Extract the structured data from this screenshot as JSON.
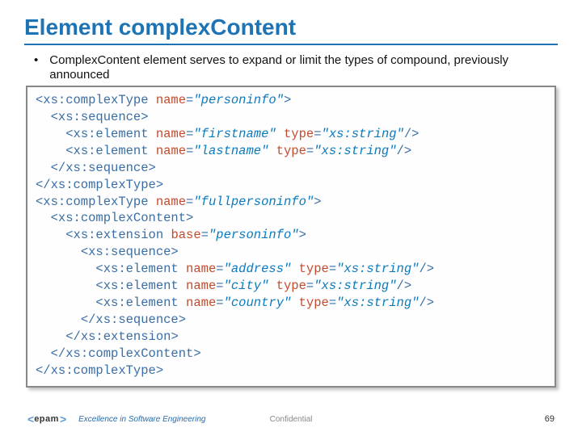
{
  "title": "Element complexContent",
  "bullet": "ComplexContent element serves to expand or limit the types of compound, previously announced",
  "code": {
    "l1": {
      "o": "<xs:complexType",
      "a1": " name",
      "v1": "\"personinfo\"",
      "c": ">"
    },
    "l2": {
      "t": "<xs:sequence>"
    },
    "l3": {
      "o": "<xs:element",
      "a1": " name",
      "v1": "\"firstname\"",
      "a2": " type",
      "v2": "\"xs:string\"",
      "c": "/>"
    },
    "l4": {
      "o": "<xs:element",
      "a1": " name",
      "v1": "\"lastname\"",
      "a2": " type",
      "v2": "\"xs:string\"",
      "c": "/>"
    },
    "l5": {
      "t": "</xs:sequence>"
    },
    "l6": {
      "t": "</xs:complexType>"
    },
    "l7": {
      "o": "<xs:complexType",
      "a1": " name",
      "v1": "\"fullpersoninfo\"",
      "c": ">"
    },
    "l8": {
      "t": "<xs:complexContent>"
    },
    "l9": {
      "o": "<xs:extension",
      "a1": " base",
      "v1": "\"personinfo\"",
      "c": ">"
    },
    "l10": {
      "t": "<xs:sequence>"
    },
    "l11": {
      "o": "<xs:element",
      "a1": " name",
      "v1": "\"address\"",
      "a2": " type",
      "v2": "\"xs:string\"",
      "c": "/>"
    },
    "l12": {
      "o": "<xs:element",
      "a1": " name",
      "v1": "\"city\"",
      "a2": " type",
      "v2": "\"xs:string\"",
      "c": "/>"
    },
    "l13": {
      "o": "<xs:element",
      "a1": " name",
      "v1": "\"country\"",
      "a2": " type",
      "v2": "\"xs:string\"",
      "c": "/>"
    },
    "l14": {
      "t": "</xs:sequence>"
    },
    "l15": {
      "t": "</xs:extension>"
    },
    "l16": {
      "t": "</xs:complexContent>"
    },
    "l17": {
      "t": "</xs:complexType>"
    }
  },
  "footer": {
    "logo_brand": "epam",
    "logo_open": "<",
    "logo_close": ">",
    "tagline": "Excellence in Software Engineering",
    "confidential": "Confidential",
    "page": "69"
  }
}
